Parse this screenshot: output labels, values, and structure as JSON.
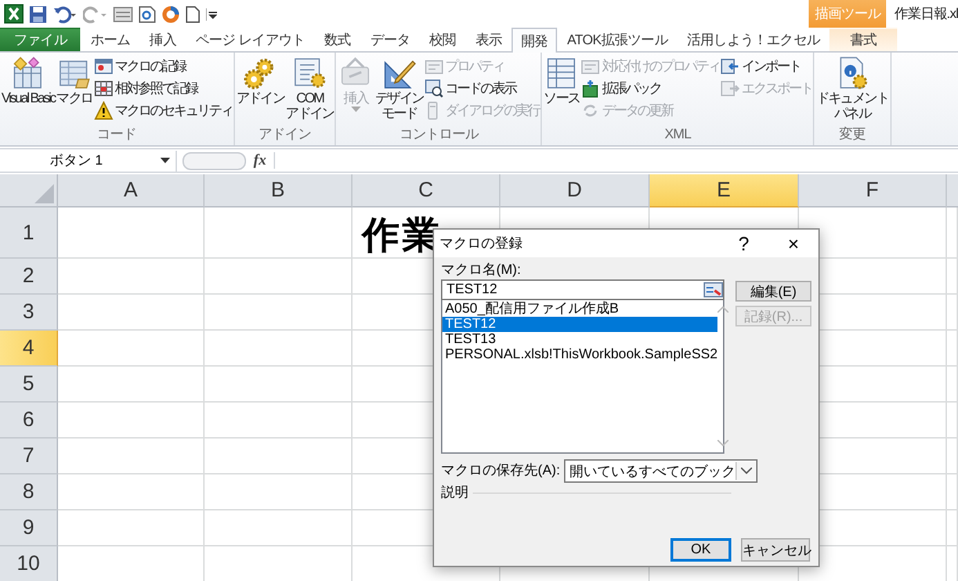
{
  "window": {
    "title": "作業日報.xl",
    "contextual_group": "描画ツール"
  },
  "tabs": [
    {
      "label": "ファイル",
      "kind": "file",
      "selected": false
    },
    {
      "label": "ホーム",
      "kind": "normal",
      "selected": false
    },
    {
      "label": "挿入",
      "kind": "normal",
      "selected": false
    },
    {
      "label": "ページ レイアウト",
      "kind": "normal",
      "selected": false
    },
    {
      "label": "数式",
      "kind": "normal",
      "selected": false
    },
    {
      "label": "データ",
      "kind": "normal",
      "selected": false
    },
    {
      "label": "校閲",
      "kind": "normal",
      "selected": false
    },
    {
      "label": "表示",
      "kind": "normal",
      "selected": false
    },
    {
      "label": "開発",
      "kind": "normal",
      "selected": true
    },
    {
      "label": "ATOK拡張ツール",
      "kind": "normal",
      "selected": false
    },
    {
      "label": "活用しよう！エクセル",
      "kind": "normal",
      "selected": false
    },
    {
      "label": "書式",
      "kind": "contextual",
      "selected": false
    }
  ],
  "ribbon_groups": [
    {
      "title": "コード",
      "columns": [
        [
          {
            "label": "Visual Basic",
            "kind": "large",
            "disabled": false
          }
        ],
        [
          {
            "label": "マクロ",
            "kind": "large",
            "disabled": false
          }
        ],
        [
          {
            "label": "マクロの記録",
            "kind": "small",
            "disabled": false
          },
          {
            "label": "相対参照で記録",
            "kind": "small",
            "disabled": false
          },
          {
            "label": "マクロのセキュリティ",
            "kind": "small",
            "disabled": false
          }
        ]
      ]
    },
    {
      "title": "アドイン",
      "columns": [
        [
          {
            "label": "アドイン",
            "kind": "large",
            "disabled": false
          }
        ],
        [
          {
            "lines": [
              "COM",
              "アドイン"
            ],
            "kind": "large",
            "disabled": false
          }
        ]
      ]
    },
    {
      "title": "コントロール",
      "columns": [
        [
          {
            "label": "挿入",
            "kind": "large",
            "disabled": true,
            "dropdown": true
          }
        ],
        [
          {
            "lines": [
              "デザイン",
              "モード"
            ],
            "kind": "large",
            "disabled": false
          }
        ],
        [
          {
            "label": "プロパティ",
            "kind": "small",
            "disabled": true
          },
          {
            "label": "コードの表示",
            "kind": "small",
            "disabled": false
          },
          {
            "label": "ダイアログの実行",
            "kind": "small",
            "disabled": true
          }
        ]
      ]
    },
    {
      "title": "XML",
      "columns": [
        [
          {
            "label": "ソース",
            "kind": "large",
            "disabled": false
          }
        ],
        [
          {
            "label": "対応付けのプロパティ",
            "kind": "small",
            "disabled": true
          },
          {
            "label": "拡張パック",
            "kind": "small",
            "disabled": false
          },
          {
            "label": "データの更新",
            "kind": "small",
            "disabled": true
          }
        ],
        [
          {
            "label": "インポート",
            "kind": "small",
            "disabled": false
          },
          {
            "label": "エクスポート",
            "kind": "small",
            "disabled": true
          }
        ]
      ]
    },
    {
      "title": "変更",
      "columns": [
        [
          {
            "lines": [
              "ドキュメント",
              "パネル"
            ],
            "kind": "large",
            "disabled": false
          }
        ]
      ]
    }
  ],
  "formula_bar": {
    "name_box": "ボタン 1",
    "function_button": "fx"
  },
  "sheet": {
    "columns": [
      {
        "label": "A",
        "selected": false
      },
      {
        "label": "B",
        "selected": false
      },
      {
        "label": "C",
        "selected": false
      },
      {
        "label": "D",
        "selected": false
      },
      {
        "label": "E",
        "selected": true
      },
      {
        "label": "F",
        "selected": false
      }
    ],
    "rows": [
      {
        "label": "1",
        "selected": false,
        "title": "作業"
      },
      {
        "label": "2",
        "selected": false
      },
      {
        "label": "3",
        "selected": false
      },
      {
        "label": "4",
        "selected": true
      },
      {
        "label": "5",
        "selected": false
      },
      {
        "label": "6",
        "selected": false
      },
      {
        "label": "7",
        "selected": false
      },
      {
        "label": "8",
        "selected": false
      },
      {
        "label": "9",
        "selected": false
      },
      {
        "label": "10",
        "selected": false
      }
    ]
  },
  "dialog": {
    "title": "マクロの登録",
    "help": "?",
    "close": "×",
    "name_label": "マクロ名(M):",
    "name_value": "TEST12",
    "macros": [
      {
        "name": "A050_配信用ファイル作成B",
        "selected": false
      },
      {
        "name": "TEST12",
        "selected": true
      },
      {
        "name": "TEST13",
        "selected": false
      },
      {
        "name": "PERSONAL.xlsb!ThisWorkbook.SampleSS2",
        "selected": false
      }
    ],
    "side_buttons": [
      {
        "label": "編集(E)",
        "disabled": false
      },
      {
        "label": "記録(R)...",
        "disabled": true
      }
    ],
    "store_label": "マクロの保存先(A):",
    "store_value": "開いているすべてのブック",
    "description_label": "説明",
    "actions": [
      {
        "label": "OK",
        "default": true
      },
      {
        "label": "キャンセル",
        "default": false
      }
    ]
  }
}
